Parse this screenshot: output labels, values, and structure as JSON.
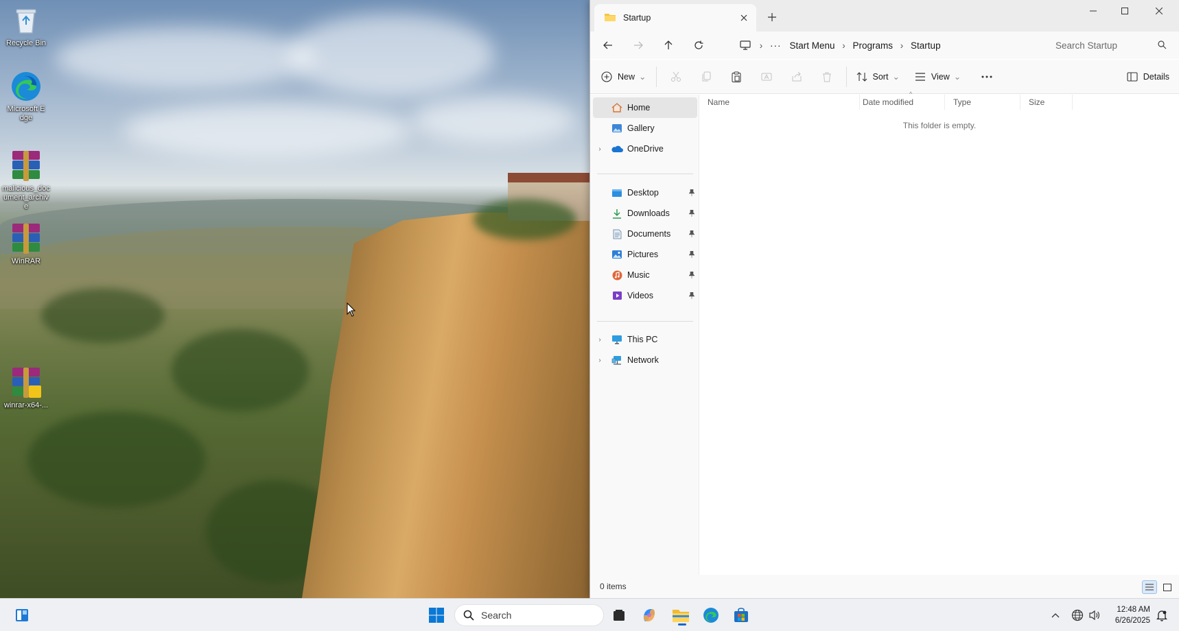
{
  "desktop": {
    "icons": [
      {
        "label": "Recycle Bin"
      },
      {
        "label": "Microsoft Edge"
      },
      {
        "label": "malicious_document_archive"
      },
      {
        "label": "WinRAR"
      },
      {
        "label": "winrar-x64-..."
      }
    ]
  },
  "explorer": {
    "tab_title": "Startup",
    "new_tab_icon": "plus-icon",
    "window_controls": [
      "minimize",
      "maximize",
      "close"
    ],
    "breadcrumbs": [
      "Start Menu",
      "Programs",
      "Startup"
    ],
    "search_placeholder": "Search Startup",
    "commands": {
      "new_label": "New",
      "sort_label": "Sort",
      "view_label": "View",
      "details_label": "Details"
    },
    "sidebar": {
      "top": [
        {
          "label": "Home",
          "selected": true
        },
        {
          "label": "Gallery"
        },
        {
          "label": "OneDrive",
          "expandable": true
        }
      ],
      "pinned": [
        {
          "label": "Desktop"
        },
        {
          "label": "Downloads"
        },
        {
          "label": "Documents"
        },
        {
          "label": "Pictures"
        },
        {
          "label": "Music"
        },
        {
          "label": "Videos"
        }
      ],
      "bottom": [
        {
          "label": "This PC",
          "expandable": true
        },
        {
          "label": "Network",
          "expandable": true
        }
      ]
    },
    "columns": [
      "Name",
      "Date modified",
      "Type",
      "Size"
    ],
    "empty_message": "This folder is empty.",
    "status_text": "0 items"
  },
  "taskbar": {
    "search_label": "Search",
    "clock_time": "12:48 AM",
    "clock_date": "6/26/2025",
    "accent": "#0067c0"
  }
}
